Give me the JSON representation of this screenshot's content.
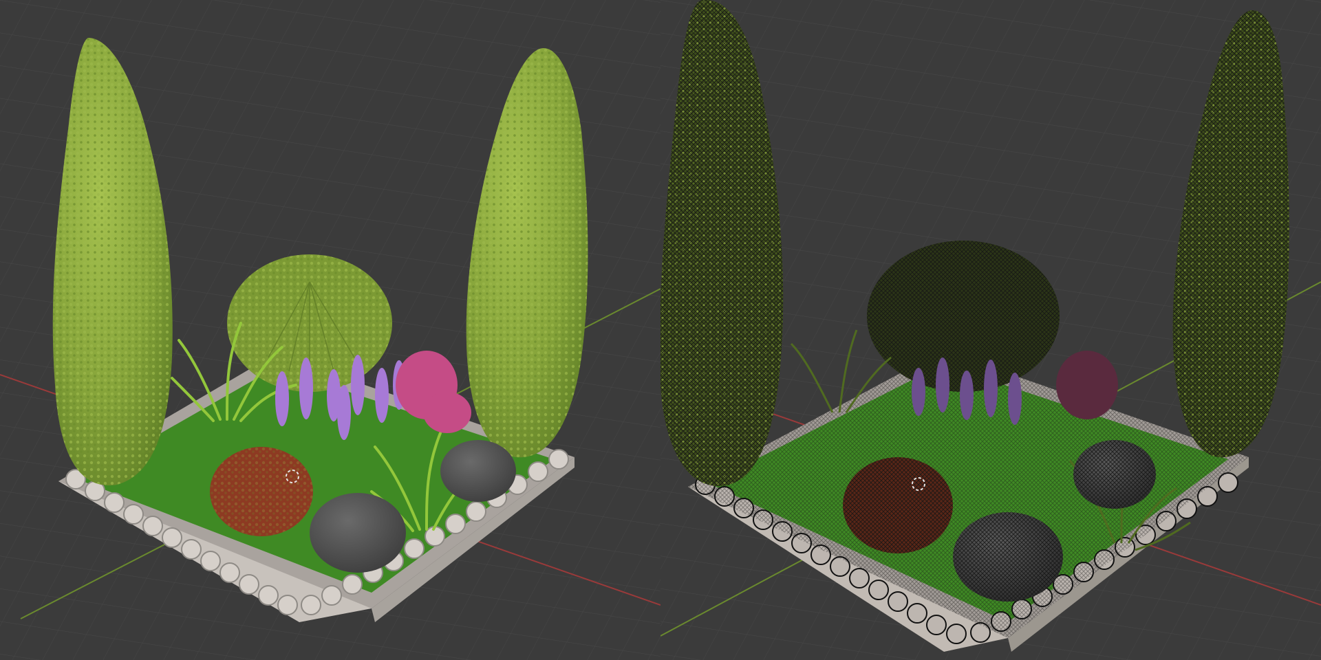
{
  "app": {
    "kind": "3D viewport comparison"
  },
  "viewports": [
    {
      "id": "left",
      "mode": "textured",
      "elements": [
        "cypress-left",
        "cypress-right",
        "round-shrub",
        "grass-tuft",
        "purple-flowers",
        "pink-flowers",
        "red-shrub",
        "rock-front",
        "rock-back",
        "plinth-border"
      ]
    },
    {
      "id": "right",
      "mode": "wireframe-overlay",
      "elements": [
        "cypress-left",
        "cypress-right",
        "round-shrub",
        "grass-tuft",
        "purple-flowers",
        "pink-flowers",
        "red-shrub",
        "rock-front",
        "rock-back",
        "plinth-border"
      ]
    }
  ],
  "colors": {
    "background": "#3b3b3b",
    "grid": "#474747",
    "axis_x": "#9a3a3a",
    "axis_y": "#6a8a2e",
    "foliage": "#86a43a",
    "foliage_dark": "#2f3d17",
    "flower_purple": "#a77ad6",
    "flower_pink": "#c54c86",
    "shrub_red": "#8d3a22",
    "rock": "#545454",
    "plinth": "#b9b3ae",
    "lawn": "#3c7f24",
    "cursor": "#e6e6e6"
  }
}
